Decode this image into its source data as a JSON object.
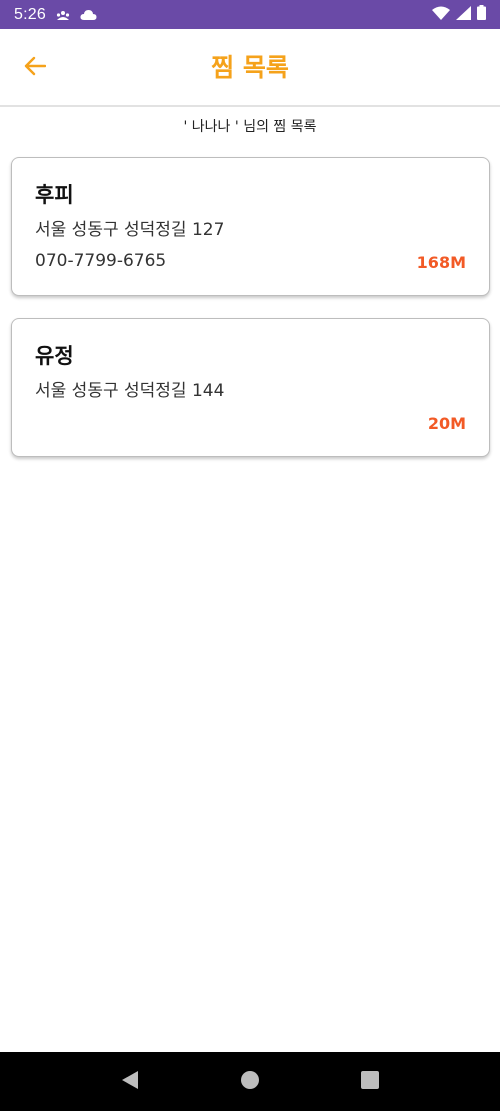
{
  "status_bar": {
    "time": "5:26"
  },
  "header": {
    "title": "찜 목록"
  },
  "subtitle": "' 나나나 ' 님의 찜 목록",
  "favorites": [
    {
      "name": "후피",
      "address": "서울 성동구 성덕정길 127",
      "phone": "070-7799-6765",
      "distance": "168M"
    },
    {
      "name": "유정",
      "address": "서울 성동구 성덕정길 144",
      "phone": "",
      "distance": "20M"
    }
  ],
  "colors": {
    "status_bar": "#6a4aa7",
    "accent": "#f5a21b",
    "distance": "#f25a26"
  },
  "icons": {
    "back": "arrow-left-icon",
    "status_left": [
      "notification-icon",
      "cloud-icon"
    ],
    "status_right": [
      "wifi-icon",
      "signal-icon",
      "battery-icon"
    ],
    "nav": [
      "back-triangle-icon",
      "home-circle-icon",
      "recents-square-icon"
    ]
  }
}
